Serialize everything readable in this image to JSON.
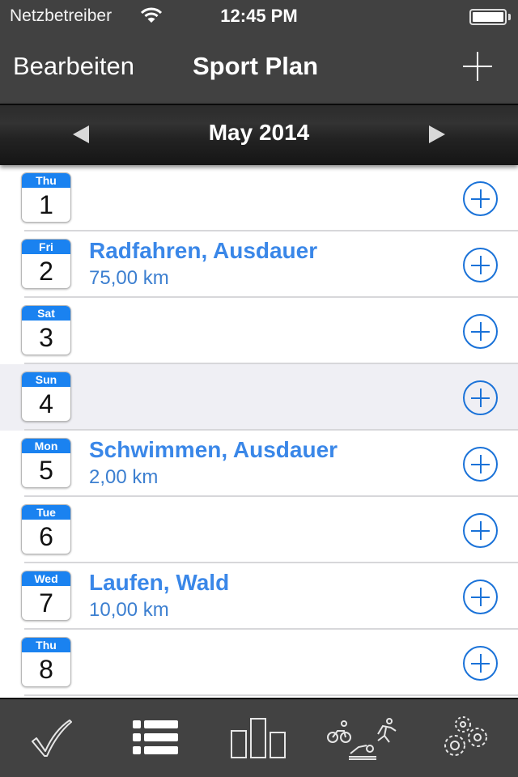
{
  "status_bar": {
    "carrier": "Netzbetreiber",
    "time": "12:45 PM",
    "wifi_icon": "wifi-icon",
    "battery_icon": "battery-icon"
  },
  "nav_bar": {
    "edit_label": "Bearbeiten",
    "title": "Sport Plan",
    "add_icon": "plus-icon"
  },
  "month_bar": {
    "label": "May 2014",
    "prev_icon": "triangle-left-icon",
    "next_icon": "triangle-right-icon"
  },
  "days": [
    {
      "weekday": "Thu",
      "day": "1",
      "title": "",
      "detail": "",
      "selected": false
    },
    {
      "weekday": "Fri",
      "day": "2",
      "title": "Radfahren, Ausdauer",
      "detail": "75,00 km",
      "selected": false
    },
    {
      "weekday": "Sat",
      "day": "3",
      "title": "",
      "detail": "",
      "selected": false
    },
    {
      "weekday": "Sun",
      "day": "4",
      "title": "",
      "detail": "",
      "selected": true
    },
    {
      "weekday": "Mon",
      "day": "5",
      "title": "Schwimmen, Ausdauer",
      "detail": "2,00 km",
      "selected": false
    },
    {
      "weekday": "Tue",
      "day": "6",
      "title": "",
      "detail": "",
      "selected": false
    },
    {
      "weekday": "Wed",
      "day": "7",
      "title": "Laufen, Wald",
      "detail": "10,00 km",
      "selected": false
    },
    {
      "weekday": "Thu",
      "day": "8",
      "title": "",
      "detail": "",
      "selected": false
    }
  ],
  "tab_bar": {
    "tabs": [
      {
        "icon": "checkmark-icon",
        "active": false
      },
      {
        "icon": "list-icon",
        "active": true
      },
      {
        "icon": "bar-chart-icon",
        "active": false
      },
      {
        "icon": "triathlon-icon",
        "active": false
      },
      {
        "icon": "gears-icon",
        "active": false
      }
    ]
  },
  "colors": {
    "accent_blue": "#1a82f0",
    "title_blue": "#3a87e8",
    "bar_dark": "#414141",
    "selected_row": "#efeff4"
  }
}
